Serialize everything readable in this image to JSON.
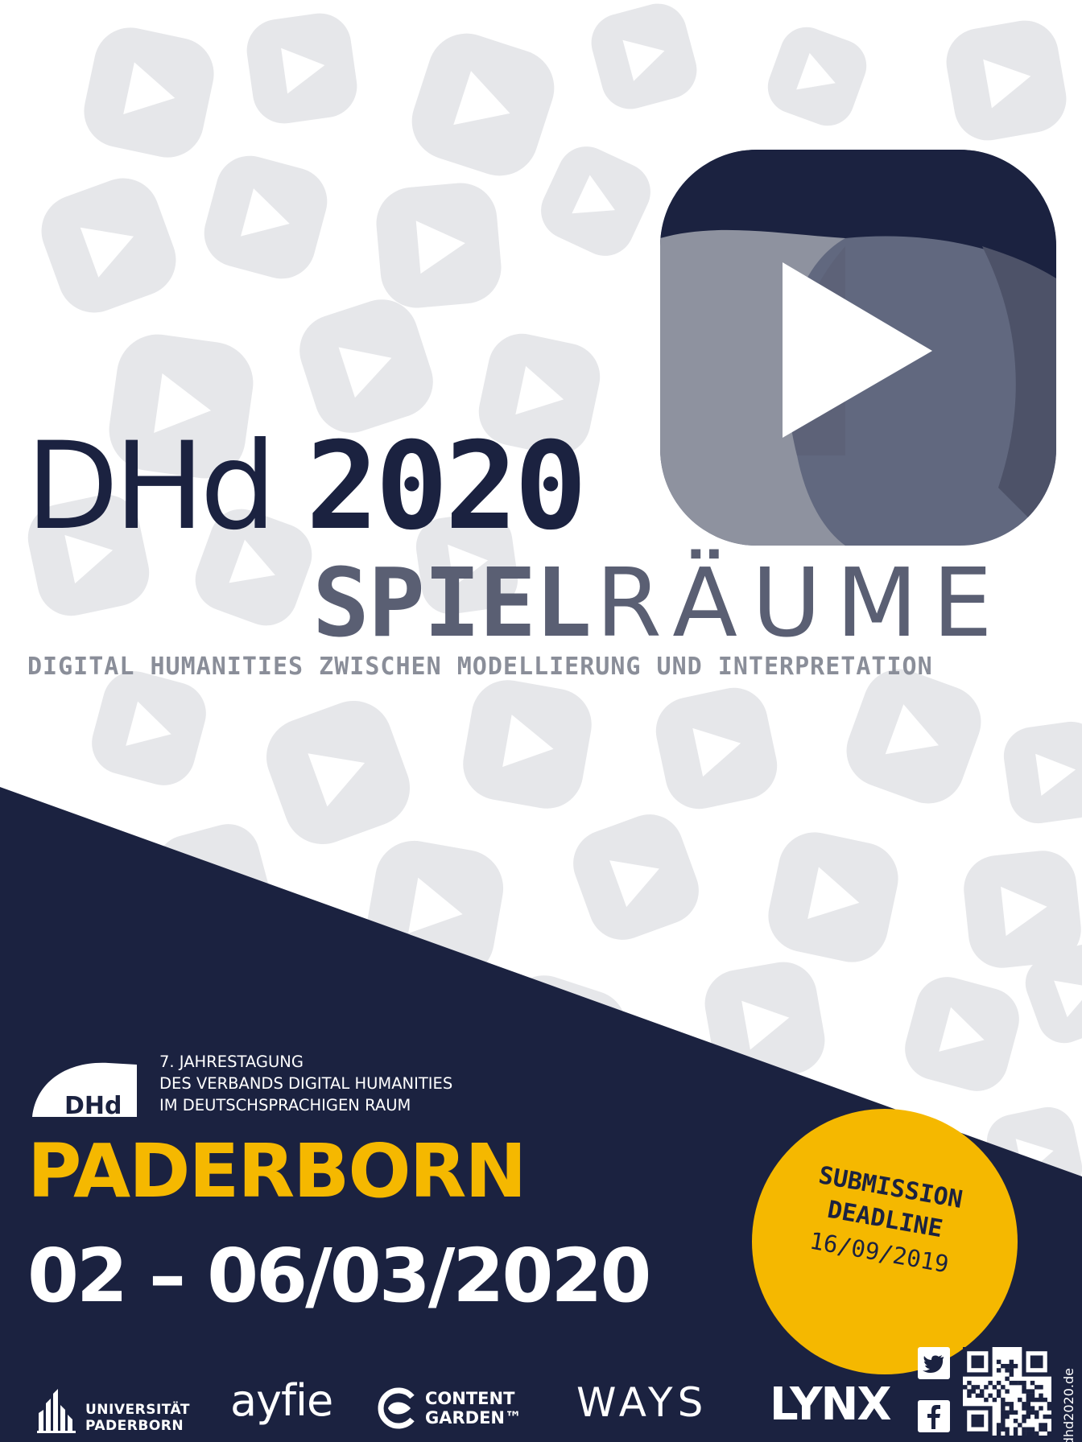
{
  "colors": {
    "navy": "#1b2240",
    "slate": "#5a5f73",
    "gray": "#8a8e99",
    "yellow": "#f5b800",
    "white": "#ffffff"
  },
  "title": {
    "dhd": "DHd",
    "year": "2020",
    "spiel": "SPIEL",
    "raeume": "RÄUME",
    "subtitle": "DIGITAL HUMANITIES ZWISCHEN MODELLIERUNG UND INTERPRETATION"
  },
  "main_logo_icon": "play-icon",
  "association": {
    "logo_text": "DHd",
    "line1": "7. JAHRESTAGUNG",
    "line2": "DES VERBANDS DIGITAL HUMANITIES",
    "line3": "IM DEUTSCHSPRACHIGEN RAUM"
  },
  "event": {
    "city": "PADERBORN",
    "dates": "02 – 06/03/2020"
  },
  "deadline": {
    "line1": "SUBMISSION",
    "line2": "DEADLINE",
    "date": "16/09/2019"
  },
  "sponsors": {
    "upb_line1": "UNIVERSITÄT",
    "upb_line2": "PADERBORN",
    "ayfie": "ayfie",
    "cg_line1": "CONTENT",
    "cg_line2": "GARDEN™",
    "ways": "WAYS",
    "lynx": "LYNX"
  },
  "social_icons": [
    "twitter-icon",
    "facebook-icon"
  ],
  "website": "dhd2020.de"
}
